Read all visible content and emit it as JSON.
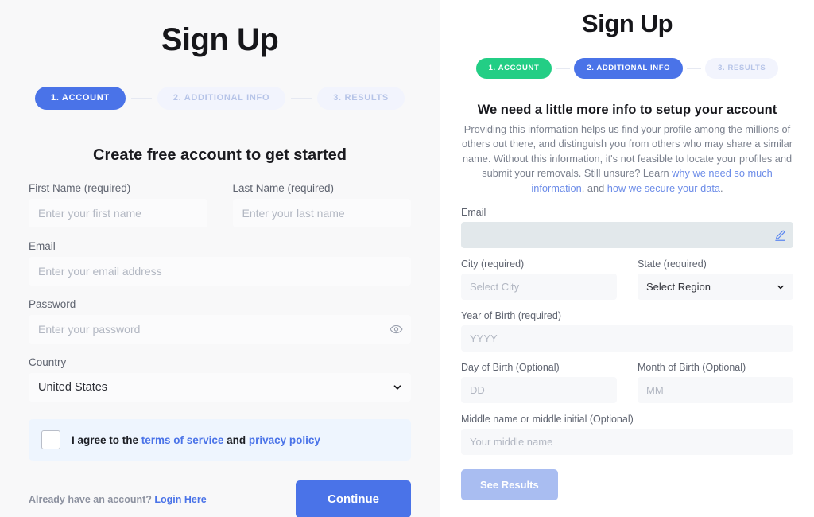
{
  "left": {
    "title": "Sign Up",
    "steps": [
      {
        "label": "1. ACCOUNT",
        "state": "active"
      },
      {
        "label": "2. ADDITIONAL INFO",
        "state": "idle"
      },
      {
        "label": "3. RESULTS",
        "state": "idle"
      }
    ],
    "heading": "Create free account to get started",
    "fields": {
      "first_name": {
        "label": "First Name (required)",
        "placeholder": "Enter your first name",
        "value": ""
      },
      "last_name": {
        "label": "Last Name (required)",
        "placeholder": "Enter your last name",
        "value": ""
      },
      "email": {
        "label": "Email",
        "placeholder": "Enter your email address",
        "value": ""
      },
      "password": {
        "label": "Password",
        "placeholder": "Enter your password",
        "value": ""
      },
      "country": {
        "label": "Country",
        "value": "United States"
      }
    },
    "agree": {
      "prefix": "I agree to the ",
      "terms": "terms of service",
      "middle": " and ",
      "privacy": "privacy policy"
    },
    "login_prompt": "Already have an account? ",
    "login_link": "Login Here",
    "continue_label": "Continue"
  },
  "right": {
    "title": "Sign Up",
    "steps": [
      {
        "label": "1. ACCOUNT",
        "state": "done"
      },
      {
        "label": "2. ADDITIONAL INFO",
        "state": "active"
      },
      {
        "label": "3. RESULTS",
        "state": "idle"
      }
    ],
    "heading": "We need a little more info to setup your account",
    "paragraph": {
      "part1": "Providing this information helps us find your profile among the millions of others out there, and distinguish you from others who may share a similar name. Without this information, it's not feasible to locate your profiles and submit your removals. Still unsure? Learn ",
      "link1": "why we need so much information",
      "part2": ", and ",
      "link2": "how we secure your data",
      "part3": "."
    },
    "fields": {
      "email": {
        "label": "Email",
        "value": "",
        "placeholder": ""
      },
      "city": {
        "label": "City (required)",
        "placeholder": "Select City",
        "value": ""
      },
      "state": {
        "label": "State (required)",
        "value": "Select Region"
      },
      "year": {
        "label": "Year of Birth (required)",
        "placeholder": "YYYY",
        "value": ""
      },
      "day": {
        "label": "Day of Birth (Optional)",
        "placeholder": "DD",
        "value": ""
      },
      "month": {
        "label": "Month of Birth (Optional)",
        "placeholder": "MM",
        "value": ""
      },
      "middle": {
        "label": "Middle name or middle initial (Optional)",
        "placeholder": "Your middle name",
        "value": ""
      }
    },
    "results_label": "See Results"
  },
  "colors": {
    "accent_blue": "#4a73e8",
    "accent_green": "#23ce85",
    "idle_pill_bg": "#f2f4fd",
    "idle_pill_text": "#b6c4e8",
    "agree_bg": "#eef5fe",
    "locked_field_bg": "#e2e8eb",
    "disabled_button": "#a9bdf1",
    "link": "#6c8ce8"
  }
}
